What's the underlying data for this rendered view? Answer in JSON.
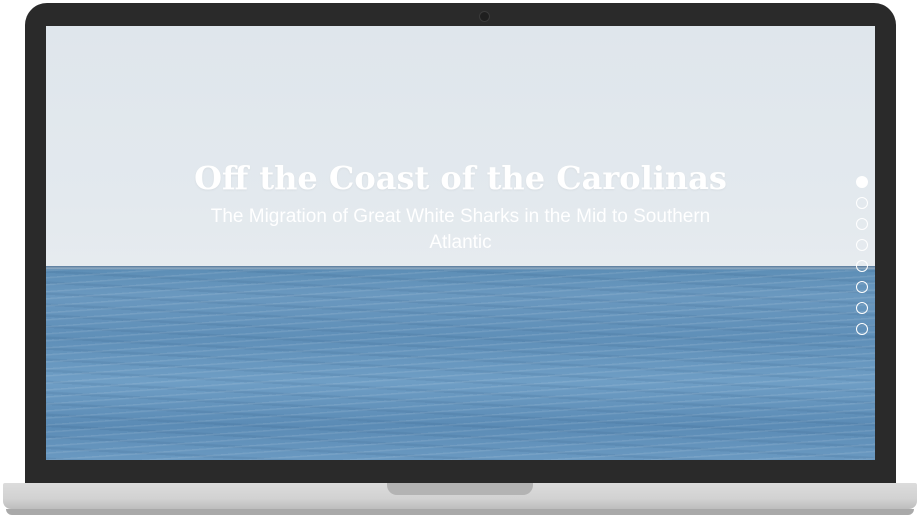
{
  "hero": {
    "title": "Off the Coast of the Carolinas",
    "subtitle": "The Migration of Great White Sharks in the Mid to Southern Atlantic"
  },
  "section_nav": {
    "dot_count": 8,
    "active_index": 0
  },
  "colors": {
    "bezel": "#2a2a2a",
    "sky": "#e3e9ee",
    "ocean": "#6a98bf",
    "text": "#ffffff",
    "base": "#d2d2d2"
  }
}
